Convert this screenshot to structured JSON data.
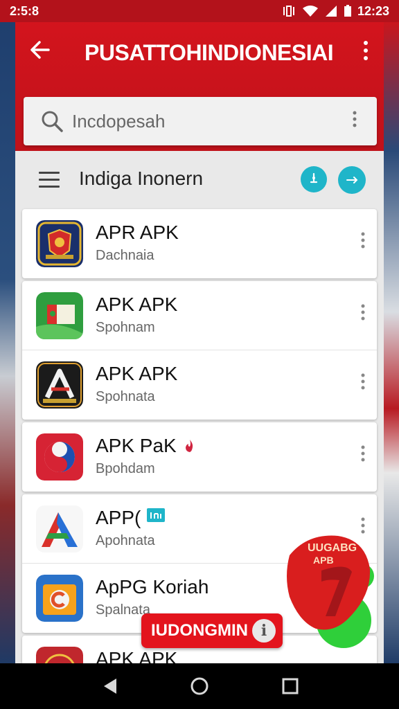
{
  "status_bar": {
    "left_text": "2:5:8",
    "time": "12:23",
    "icons": [
      "vibrate-icon",
      "wifi-icon",
      "signal-icon",
      "battery-icon"
    ]
  },
  "app_bar": {
    "title": "PUSATTOHINDIONESIAI",
    "back_icon": "arrow-left-icon",
    "overflow_icon": "more-vert-icon",
    "accent": "#d3141d"
  },
  "search": {
    "placeholder": "Incdopesah",
    "icon": "search-icon"
  },
  "sub_header": {
    "title": "Indiga Inonern",
    "menu_icon": "hamburger-icon",
    "action_icons": [
      "chat-icon",
      "share-bubble-icon"
    ]
  },
  "apps": [
    {
      "name": "APR APK",
      "subtitle": "Dachnaia",
      "icon": "coat-of-arms-icon"
    },
    {
      "name": "APK APK",
      "subtitle": "Spohnam",
      "icon": "green-flag-icon"
    },
    {
      "name": "APK APK",
      "subtitle": "Spohnata",
      "icon": "letter-a-dark-icon"
    },
    {
      "name": "APK PaK",
      "subtitle": "Bpohdam",
      "icon": "red-emblem-icon"
    },
    {
      "name": "APP(",
      "subtitle": "Apohnata",
      "icon": "letter-a-color-icon"
    },
    {
      "name": "ApPG Koriah",
      "subtitle": "Spalnata",
      "icon": "orange-c-icon"
    },
    {
      "name": "APK APK",
      "subtitle": "",
      "icon": "red-seal-icon"
    }
  ],
  "toast": {
    "label": "IUDONGMIN",
    "icon": "info-icon"
  },
  "badge": {
    "line1": "UUGABG",
    "line2": "APB"
  },
  "nav": {
    "icons": [
      "back-triangle-icon",
      "home-circle-icon",
      "recents-square-icon"
    ]
  }
}
